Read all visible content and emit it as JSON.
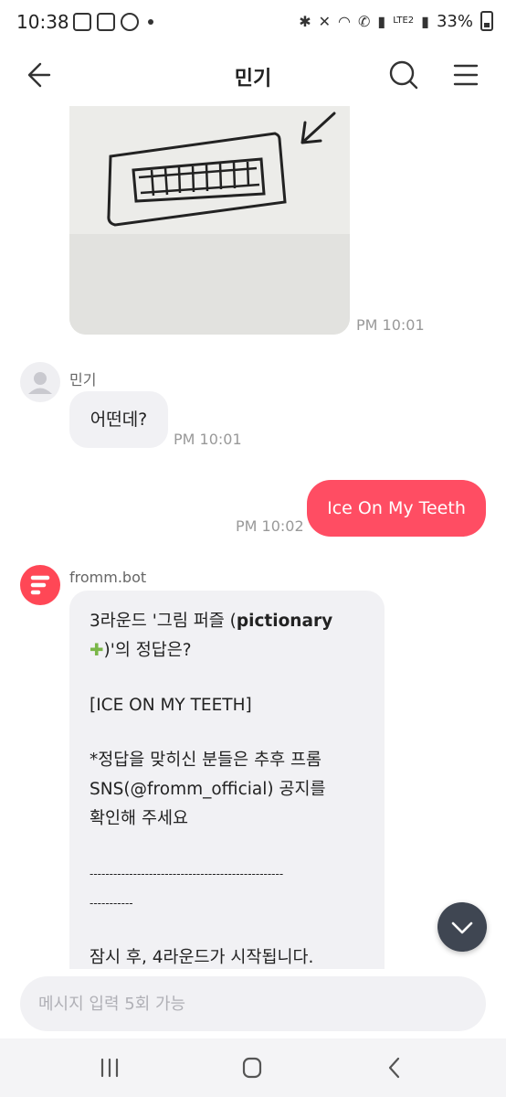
{
  "status_bar": {
    "time": "10:38",
    "battery": "33%",
    "network": "LTE2"
  },
  "header": {
    "title": "민기"
  },
  "messages": {
    "photo_time": "PM 10:01",
    "user_sender": "민기",
    "user_text": "어떤데?",
    "user_time": "PM 10:01",
    "mine_text": "Ice On My Teeth",
    "mine_time": "PM 10:02",
    "bot_sender": "fromm.bot",
    "bot_line1a": "3라운드 '그림 퍼즐 (",
    "bot_line1b": "pictionary",
    "bot_line2": ")'의 정답은?",
    "bot_answer": "[ICE ON MY TEETH]",
    "bot_notice1": "*정답을 맞히신 분들은 추후 프롬",
    "bot_notice2": "SNS(@fromm_official) 공지를",
    "bot_notice3": "확인해 주세요",
    "bot_divider1": "-------------------------------------------------",
    "bot_divider2": "-----------",
    "bot_next": "잠시 후, 4라운드가 시작됩니다."
  },
  "input": {
    "placeholder": "메시지 입력 5회 가능"
  },
  "colors": {
    "accent": "#ff4d63",
    "bot_brand": "#ff4756",
    "bubble_gray": "#f1f1f4",
    "fab": "#3f4652"
  }
}
